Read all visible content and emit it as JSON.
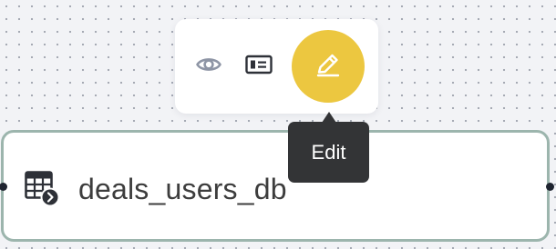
{
  "toolbar": {
    "buttons": [
      {
        "icon": "eye-icon",
        "label": "View"
      },
      {
        "icon": "id-card-icon",
        "label": "Details"
      },
      {
        "icon": "pencil-icon",
        "label": "Edit"
      }
    ],
    "accent_color": "#ecc740"
  },
  "tooltip": {
    "text": "Edit"
  },
  "node": {
    "icon": "table-icon",
    "title": "deals_users_db",
    "border_color": "#9cb5ad"
  }
}
